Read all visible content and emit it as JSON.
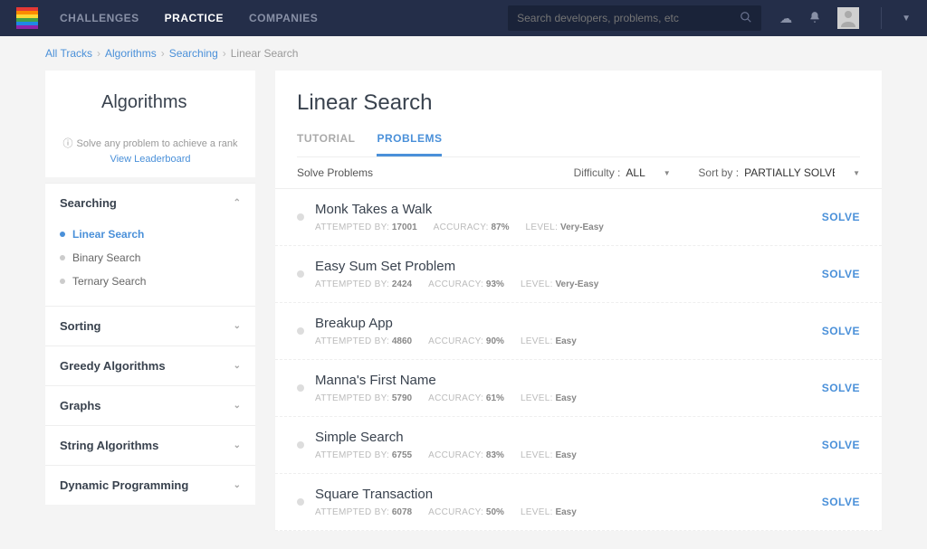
{
  "nav": {
    "links": [
      "CHALLENGES",
      "PRACTICE",
      "COMPANIES"
    ],
    "active": 1,
    "search_placeholder": "Search developers, problems, etc"
  },
  "breadcrumbs": {
    "items": [
      "All Tracks",
      "Algorithms",
      "Searching"
    ],
    "current": "Linear Search"
  },
  "sidebar": {
    "title": "Algorithms",
    "rank_text": "Solve any problem to achieve a rank",
    "leaderboard": "View Leaderboard",
    "sections": [
      {
        "name": "Searching",
        "expanded": true,
        "items": [
          {
            "label": "Linear Search",
            "active": true
          },
          {
            "label": "Binary Search",
            "active": false
          },
          {
            "label": "Ternary Search",
            "active": false
          }
        ]
      },
      {
        "name": "Sorting",
        "expanded": false
      },
      {
        "name": "Greedy Algorithms",
        "expanded": false
      },
      {
        "name": "Graphs",
        "expanded": false
      },
      {
        "name": "String Algorithms",
        "expanded": false
      },
      {
        "name": "Dynamic Programming",
        "expanded": false
      }
    ]
  },
  "main": {
    "title": "Linear Search",
    "tabs": [
      "TUTORIAL",
      "PROBLEMS"
    ],
    "active_tab": 1,
    "solve_label": "Solve Problems",
    "filters": {
      "difficulty_label": "Difficulty :",
      "difficulty_value": "ALL",
      "sort_label": "Sort by :",
      "sort_value": "PARTIALLY SOLVED"
    },
    "meta_labels": {
      "attempted": "ATTEMPTED BY:",
      "accuracy": "ACCURACY:",
      "level": "LEVEL:"
    },
    "solve_btn": "SOLVE",
    "problems": [
      {
        "title": "Monk Takes a Walk",
        "attempted": "17001",
        "accuracy": "87%",
        "level": "Very-Easy"
      },
      {
        "title": "Easy Sum Set Problem",
        "attempted": "2424",
        "accuracy": "93%",
        "level": "Very-Easy"
      },
      {
        "title": "Breakup App",
        "attempted": "4860",
        "accuracy": "90%",
        "level": "Easy"
      },
      {
        "title": "Manna's First Name",
        "attempted": "5790",
        "accuracy": "61%",
        "level": "Easy"
      },
      {
        "title": "Simple Search",
        "attempted": "6755",
        "accuracy": "83%",
        "level": "Easy"
      },
      {
        "title": "Square Transaction",
        "attempted": "6078",
        "accuracy": "50%",
        "level": "Easy"
      }
    ]
  }
}
